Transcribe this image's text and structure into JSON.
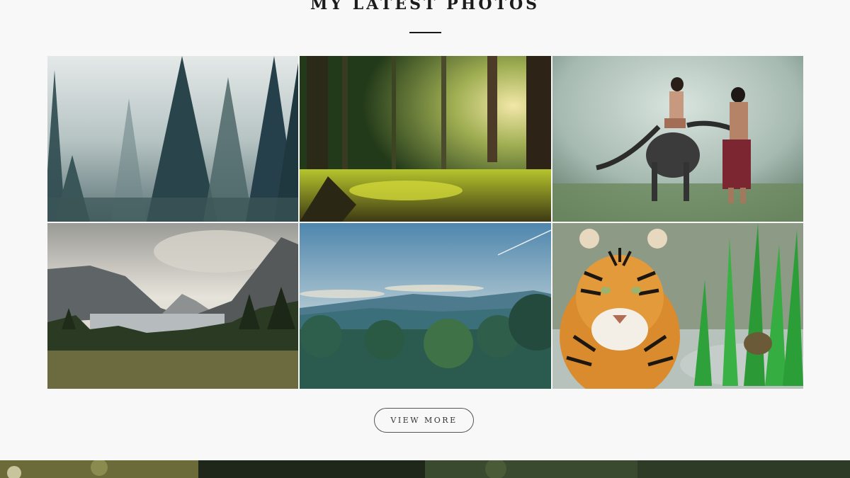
{
  "section": {
    "title": "MY LATEST PHOTOS"
  },
  "gallery": {
    "photos": [
      {
        "subject": "misty pine forest"
      },
      {
        "subject": "sunlit forest floor with moss"
      },
      {
        "subject": "woman on water buffalo with man in misty field"
      },
      {
        "subject": "mountain lake valley with pine trees"
      },
      {
        "subject": "blue sky over forested hills"
      },
      {
        "subject": "tiger walking in water beside reeds"
      }
    ]
  },
  "actions": {
    "view_more_label": "VIEW MORE"
  }
}
